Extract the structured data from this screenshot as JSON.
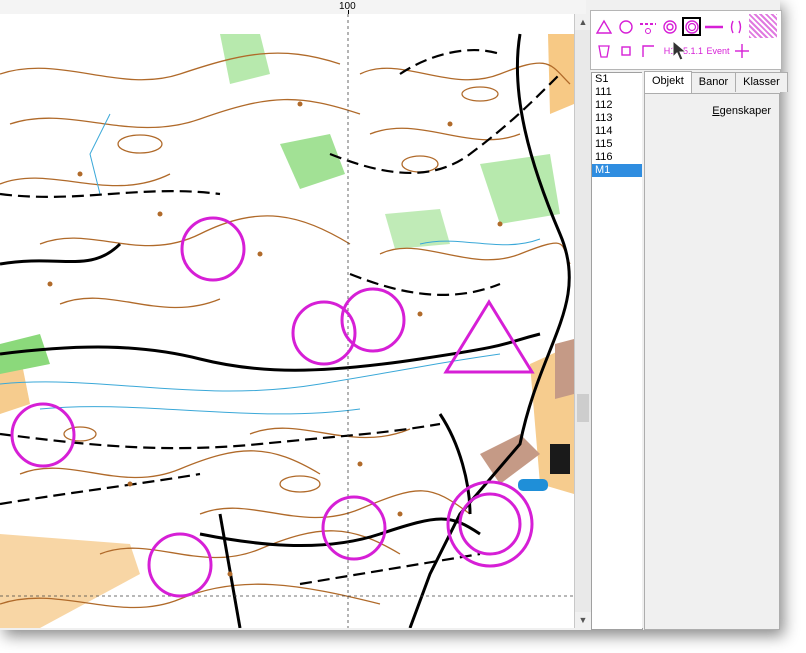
{
  "ruler": {
    "label": "100"
  },
  "palette": {
    "symbols": [
      {
        "name": "start-triangle-icon"
      },
      {
        "name": "control-circle-icon"
      },
      {
        "name": "dashed-line-icon"
      },
      {
        "name": "finish-circle-icon"
      },
      {
        "name": "double-circle-icon"
      },
      {
        "name": "course-line-icon"
      },
      {
        "name": "crossing-point-icon"
      },
      {
        "name": "restricted-area-icon"
      },
      {
        "name": "water-cup-icon"
      },
      {
        "name": "small-square-icon"
      },
      {
        "name": "corner-icon"
      },
      {
        "name": "text-h1-icon",
        "label": "H1"
      },
      {
        "name": "text-511-icon",
        "label": "5.1.1"
      },
      {
        "name": "text-event-icon",
        "label": "Event"
      },
      {
        "name": "cross-icon"
      }
    ]
  },
  "course_list": {
    "items": [
      "S1",
      "111",
      "112",
      "113",
      "114",
      "115",
      "116",
      "M1"
    ],
    "selected": "M1"
  },
  "tabs": [
    {
      "label": "Objekt",
      "active": true
    },
    {
      "label": "Banor",
      "active": false
    },
    {
      "label": "Klasser",
      "active": false
    }
  ],
  "properties": {
    "label_underlined": "E",
    "label_rest": "genskaper"
  },
  "colors": {
    "overprint": "#d61fd6",
    "contour": "#b06a2a",
    "vegetation": "#73d26a",
    "open_land": "#f5c37a",
    "water": "#3aa8d8",
    "selection": "#2f8de0"
  }
}
